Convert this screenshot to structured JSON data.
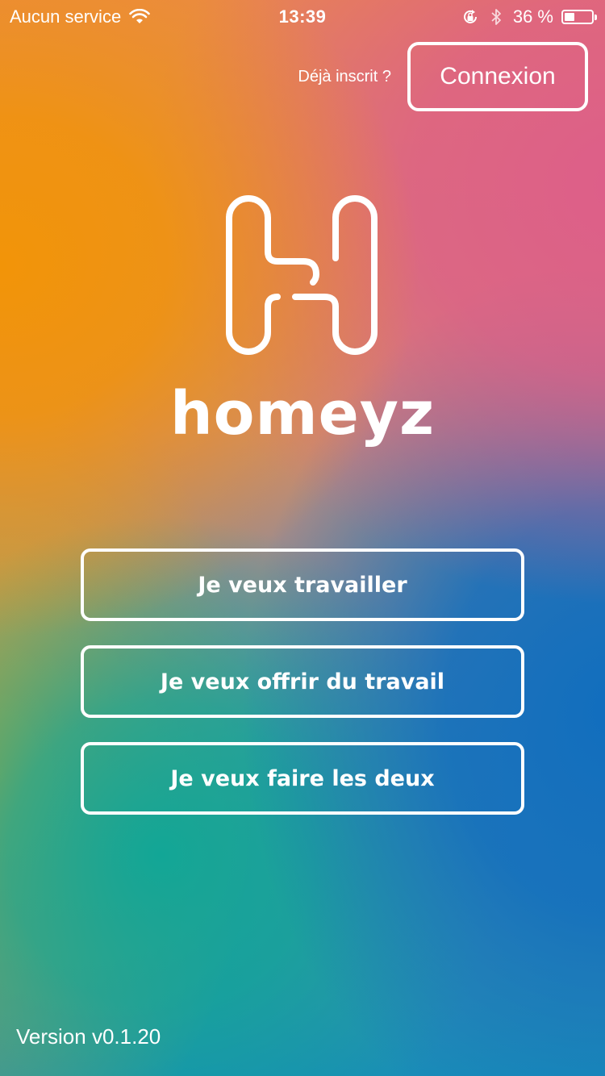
{
  "status_bar": {
    "carrier": "Aucun service",
    "time": "13:39",
    "battery_percent_text": "36 %",
    "battery_level": 0.36,
    "icons": [
      "wifi-icon",
      "lock-rotation-icon",
      "bluetooth-icon",
      "battery-icon"
    ]
  },
  "header": {
    "already_registered": "Déjà inscrit ?",
    "login_label": "Connexion"
  },
  "logo": {
    "wordmark": "homeyz",
    "icon": "homeyz-logo-icon"
  },
  "roles": [
    {
      "label": "Je veux travailler"
    },
    {
      "label": "Je veux offrir du travail"
    },
    {
      "label": "Je veux faire les deux"
    }
  ],
  "footer": {
    "version": "Version v0.1.20"
  },
  "colors": {
    "orange": "#f29408",
    "pink": "#dd5e8a",
    "blue": "#116ebe",
    "teal": "#12a696",
    "foreground": "#ffffff"
  }
}
